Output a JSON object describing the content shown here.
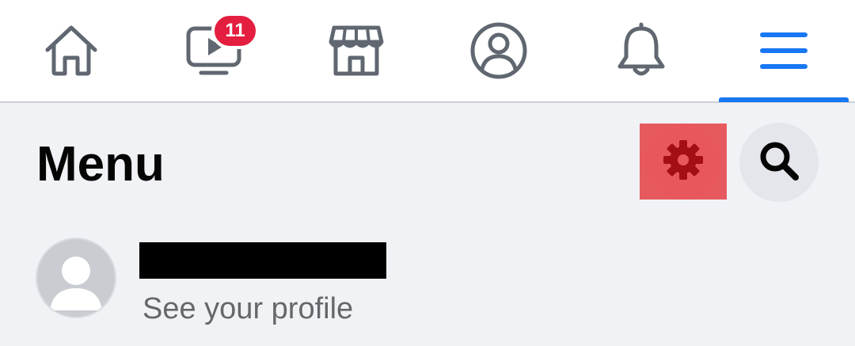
{
  "nav": {
    "items": [
      {
        "id": "home",
        "icon": "home-icon"
      },
      {
        "id": "watch",
        "icon": "video-icon",
        "badge": "11"
      },
      {
        "id": "marketplace",
        "icon": "storefront-icon"
      },
      {
        "id": "profile",
        "icon": "user-circle-icon"
      },
      {
        "id": "notifications",
        "icon": "bell-icon"
      },
      {
        "id": "menu",
        "icon": "hamburger-menu-icon",
        "active": true
      }
    ],
    "active_color": "#1877f2",
    "badge_color": "#e41e3f",
    "icon_color": "#606770"
  },
  "menu": {
    "title": "Menu",
    "actions": [
      {
        "id": "settings",
        "icon": "gear-icon",
        "highlighted": true
      },
      {
        "id": "search",
        "icon": "search-icon"
      }
    ],
    "profile": {
      "subtitle": "See your profile"
    }
  }
}
